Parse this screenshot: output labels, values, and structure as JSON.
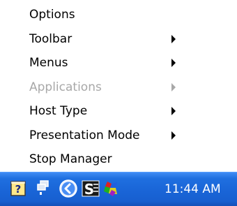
{
  "menu": {
    "items": [
      {
        "label": "Options",
        "has_submenu": false,
        "enabled": true
      },
      {
        "label": "Toolbar",
        "has_submenu": true,
        "enabled": true
      },
      {
        "label": "Menus",
        "has_submenu": true,
        "enabled": true
      },
      {
        "label": "Applications",
        "has_submenu": true,
        "enabled": false
      },
      {
        "label": "Host Type",
        "has_submenu": true,
        "enabled": true
      },
      {
        "label": "Presentation Mode",
        "has_submenu": true,
        "enabled": true
      },
      {
        "label": "Stop Manager",
        "has_submenu": false,
        "enabled": true
      }
    ]
  },
  "tray": {
    "icons": [
      "help-icon",
      "network-monitor-icon",
      "back-arrow-icon",
      "s-app-icon",
      "puzzle-app-icon"
    ],
    "clock": "11:44 AM",
    "colors": {
      "taskbar": "#1a66d8",
      "disabled_text": "#a8a8a8"
    }
  }
}
